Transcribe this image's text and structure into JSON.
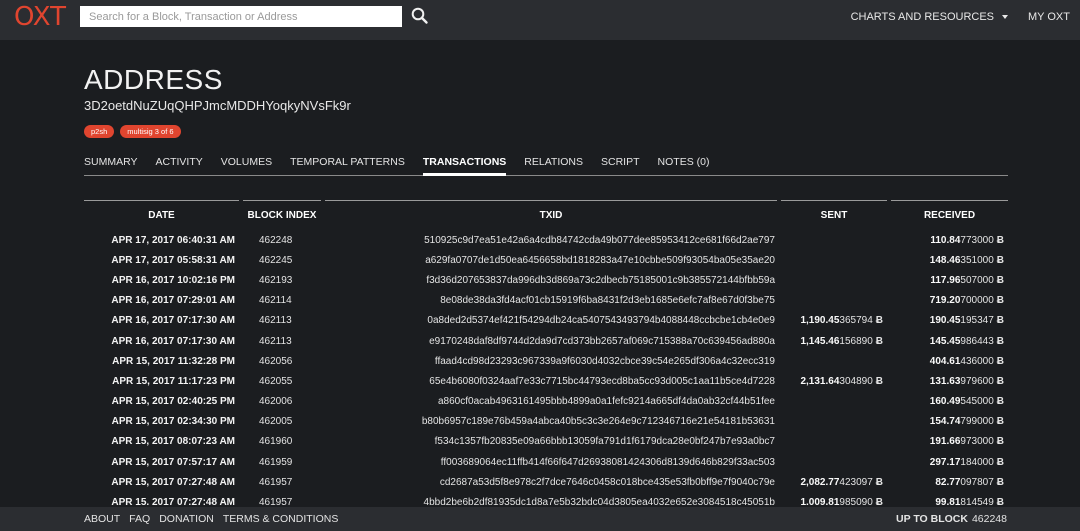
{
  "header": {
    "logo": "OXT",
    "search_placeholder": "Search for a Block, Transaction or Address",
    "search_icon": "search-icon",
    "nav": [
      {
        "label": "CHARTS AND RESOURCES",
        "icon": "chevron-down-icon"
      },
      {
        "label": "MY OXT"
      }
    ]
  },
  "page": {
    "title": "ADDRESS",
    "address": "3D2oetdNuZUqQHPJmcMDDHYoqkyNVsFk9r",
    "badges": [
      "p2sh",
      "multisig 3 of 6"
    ],
    "accent_color": "#e0452f"
  },
  "tabs": [
    {
      "label": "SUMMARY",
      "active": false
    },
    {
      "label": "ACTIVITY",
      "active": false
    },
    {
      "label": "VOLUMES",
      "active": false
    },
    {
      "label": "TEMPORAL PATTERNS",
      "active": false
    },
    {
      "label": "TRANSACTIONS",
      "active": true
    },
    {
      "label": "RELATIONS",
      "active": false
    },
    {
      "label": "SCRIPT",
      "active": false
    },
    {
      "label": "NOTES (0)",
      "active": false
    }
  ],
  "table": {
    "columns": [
      "DATE",
      "BLOCK INDEX",
      "TXID",
      "SENT",
      "RECEIVED"
    ],
    "btc_symbol": "Ƀ",
    "rows": [
      {
        "date": "APR 17, 2017 06:40:31 AM",
        "block": "462248",
        "txid": "510925c9d7ea51e42a6a4cdb84742cda49b077dee85953412ce681f66d2ae797",
        "sent": "",
        "received": "110.84773000"
      },
      {
        "date": "APR 17, 2017 05:58:31 AM",
        "block": "462245",
        "txid": "a629fa0707de1d50ea6456658bd1818283a47e10cbbe509f93054ba05e35ae20",
        "sent": "",
        "received": "148.46351000"
      },
      {
        "date": "APR 16, 2017 10:02:16 PM",
        "block": "462193",
        "txid": "f3d36d207653837da996db3d869a73c2dbecb75185001c9b385572144bfbb59a",
        "sent": "",
        "received": "117.96507000"
      },
      {
        "date": "APR 16, 2017 07:29:01 AM",
        "block": "462114",
        "txid": "8e08de38da3fd4acf01cb15919f6ba8431f2d3eb1685e6efc7af8e67d0f3be75",
        "sent": "",
        "received": "719.20700000"
      },
      {
        "date": "APR 16, 2017 07:17:30 AM",
        "block": "462113",
        "txid": "0a8ded2d5374ef421f54294db24ca5407543493794b4088448ccbcbe1cb4e0e9",
        "sent": "1,190.45365794",
        "received": "190.45195347"
      },
      {
        "date": "APR 16, 2017 07:17:30 AM",
        "block": "462113",
        "txid": "e9170248daf8df9744d2da9d7cd373bb2657af069c715388a70c639456ad880a",
        "sent": "1,145.46156890",
        "received": "145.45986443"
      },
      {
        "date": "APR 15, 2017 11:32:28 PM",
        "block": "462056",
        "txid": "ffaad4cd98d23293c967339a9f6030d4032cbce39c54e265df306a4c32ecc319",
        "sent": "",
        "received": "404.61436000"
      },
      {
        "date": "APR 15, 2017 11:17:23 PM",
        "block": "462055",
        "txid": "65e4b6080f0324aaf7e33c7715bc44793ecd8ba5cc93d005c1aa11b5ce4d7228",
        "sent": "2,131.64304890",
        "received": "131.63979600"
      },
      {
        "date": "APR 15, 2017 02:40:25 PM",
        "block": "462006",
        "txid": "a860cf0acab4963161495bbb4899a0a1fefc9214a665df4da0ab32cf44b51fee",
        "sent": "",
        "received": "160.49545000"
      },
      {
        "date": "APR 15, 2017 02:34:30 PM",
        "block": "462005",
        "txid": "b80b6957c189e76b459a4abca40b5c3c3e264e9c712346716e21e54181b53631",
        "sent": "",
        "received": "154.74799000"
      },
      {
        "date": "APR 15, 2017 08:07:23 AM",
        "block": "461960",
        "txid": "f534c1357fb20835e09a66bbb13059fa791d1f6179dca28e0bf247b7e93a0bc7",
        "sent": "",
        "received": "191.66973000"
      },
      {
        "date": "APR 15, 2017 07:57:17 AM",
        "block": "461959",
        "txid": "ff003689064ec11ffb414f66f647d26938081424306d8139d646b829f33ac503",
        "sent": "",
        "received": "297.17184000"
      },
      {
        "date": "APR 15, 2017 07:27:48 AM",
        "block": "461957",
        "txid": "cd2687a53d5f8e978c2f7dce7646c0458c018bce435e53fb0bff9e7f9040c79e",
        "sent": "2,082.77423097",
        "received": "82.77097807"
      },
      {
        "date": "APR 15, 2017 07:27:48 AM",
        "block": "461957",
        "txid": "4bbd2be6b2df81935dc1d8a7e5b32bdc04d3805ea4032e652e3084518c45051b",
        "sent": "1,009.81985090",
        "received": "99.81814549"
      }
    ]
  },
  "footer": {
    "links": [
      "ABOUT",
      "FAQ",
      "DONATION",
      "TERMS & CONDITIONS"
    ],
    "up_to_label": "UP TO BLOCK",
    "up_to_value": "462248"
  }
}
